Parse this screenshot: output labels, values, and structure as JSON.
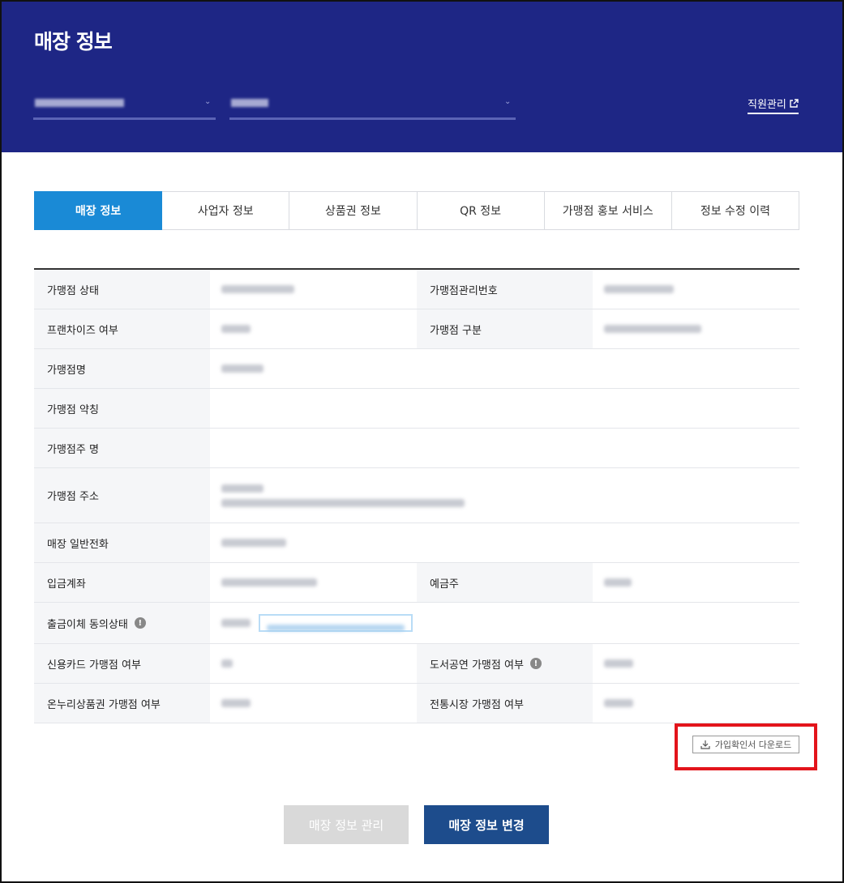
{
  "header": {
    "title": "매장 정보",
    "staff_link": "직원관리"
  },
  "tabs": [
    "매장 정보",
    "사업자 정보",
    "상품권 정보",
    "QR 정보",
    "가맹점 홍보 서비스",
    "정보 수정 이력"
  ],
  "active_tab": 0,
  "table": {
    "labels": {
      "status": "가맹점 상태",
      "mgmt_no": "가맹점관리번호",
      "franchise": "프랜차이즈 여부",
      "category": "가맹점 구분",
      "name": "가맹점명",
      "abbr": "가맹점 약칭",
      "owner": "가맹점주 명",
      "address": "가맹점 주소",
      "phone": "매장 일반전화",
      "account": "입금계좌",
      "depositor": "예금주",
      "withdraw": "출금이체 동의상태",
      "credit_card": "신용카드 가맹점 여부",
      "culture": "도서공연 가맹점 여부",
      "onnuri": "온누리상품권 가맹점 여부",
      "market": "전통시장 가맹점 여부"
    }
  },
  "download_label": "가입확인서 다운로드",
  "buttons": {
    "manage": "매장 정보 관리",
    "change": "매장 정보 변경"
  },
  "colors": {
    "header_bg": "#1e2685",
    "tab_active": "#1a8ad6",
    "primary_button": "#1d4c8c",
    "highlight": "#e3141b"
  }
}
